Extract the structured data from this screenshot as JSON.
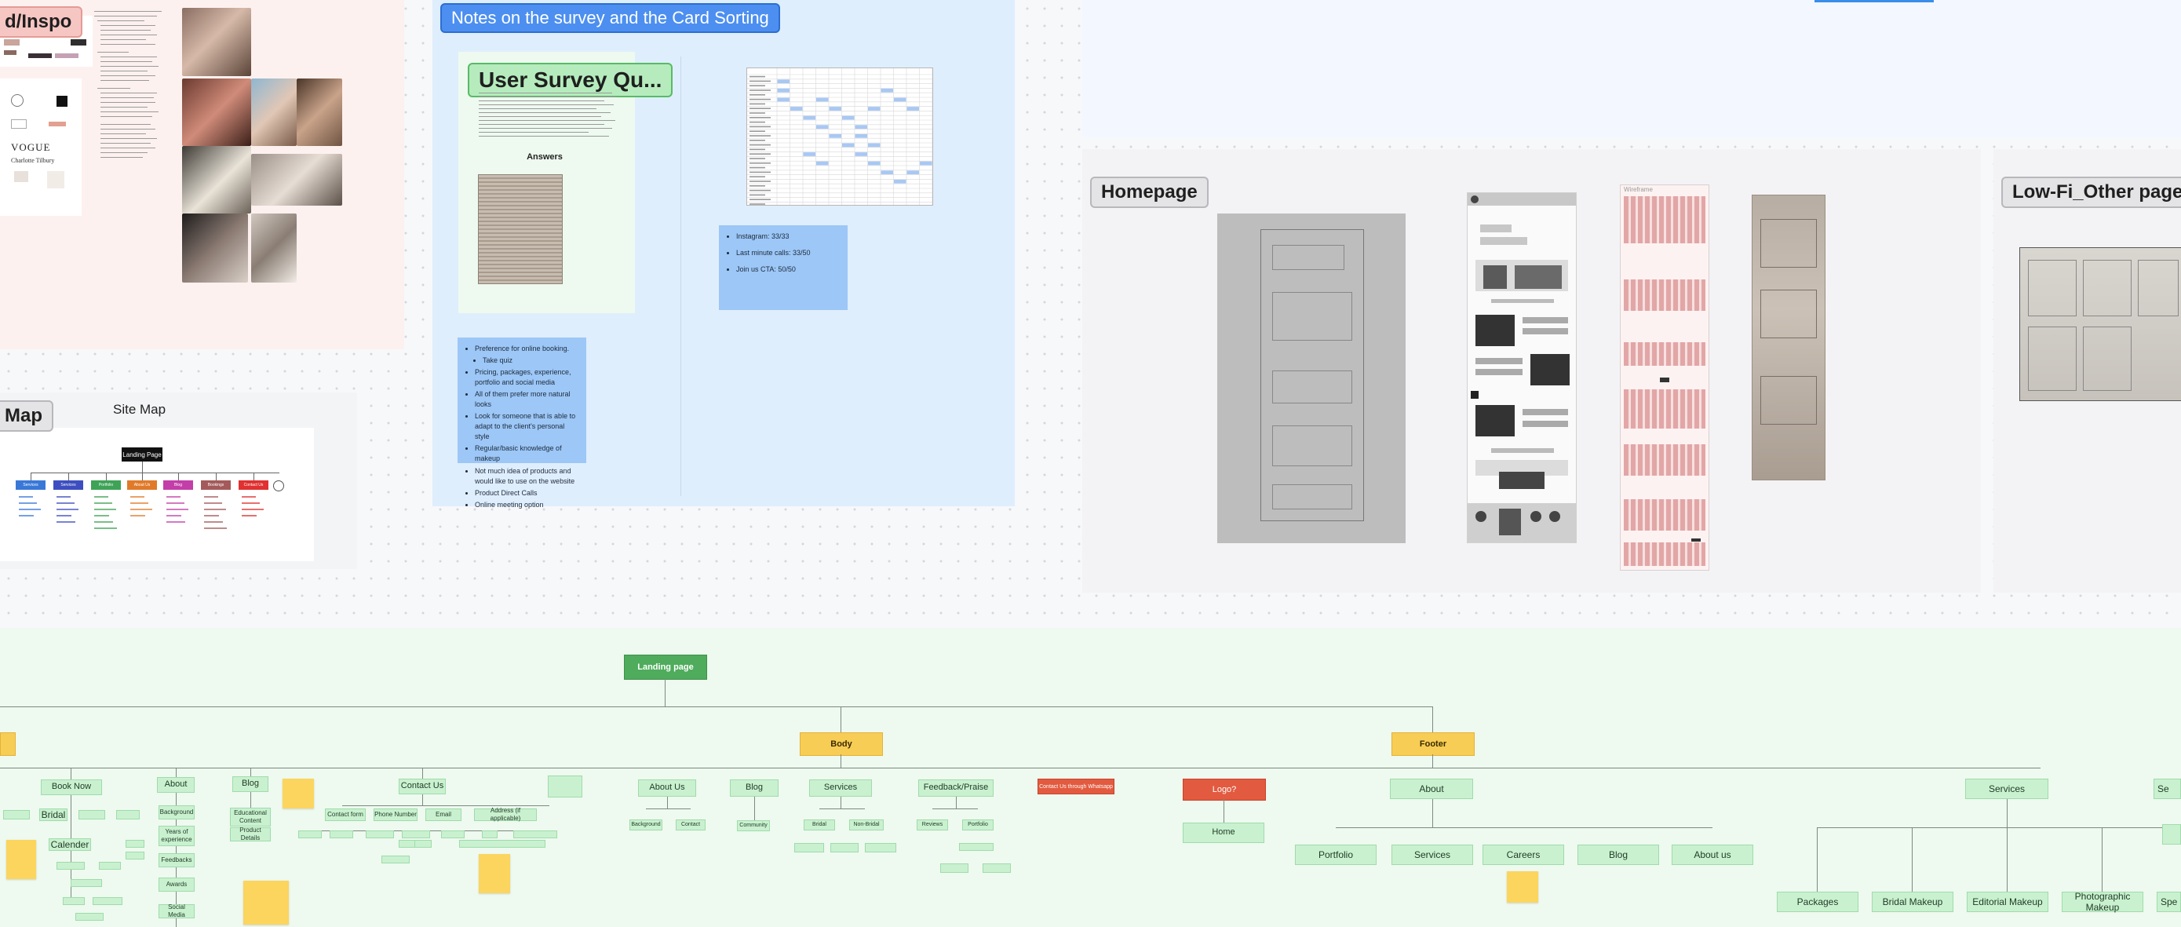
{
  "frames": {
    "moodboard_title": "d/Inspo",
    "notes_title": "Notes on the survey and the Card Sorting",
    "survey_title": "User Survey Qu...",
    "answers_label": "Answers",
    "sitemap_title": "Map",
    "sitemap_subtitle": "Site Map",
    "sitemap_landing": "Landing Page",
    "homepage_title": "Homepage",
    "lowfi_title": "Low-Fi_Other pages",
    "wireframe_label": "Wireframe"
  },
  "moodboard": {
    "vogue_text": "VOGUE",
    "brand_text": "Charlotte Tilbury"
  },
  "notes_sticky": {
    "items": [
      "Preference for online booking.",
      "Take quiz",
      "Pricing, packages, experience, portfolio and social media",
      "All of them prefer more natural looks",
      "Look for someone that is able to adapt to the client's personal style",
      "Regular/basic knowledge of makeup",
      "Not much idea of products and would like to use on the website",
      "Product Direct Calls",
      "Online meeting option"
    ]
  },
  "card_sort_sticky": {
    "items": [
      "Instagram: 33/33",
      "Last minute calls: 33/50",
      "Join us CTA: 50/50"
    ]
  },
  "sitemap_categories": [
    {
      "label": "Services",
      "color": "#3a78d8"
    },
    {
      "label": "Services",
      "color": "#3d4fc0"
    },
    {
      "label": "Portfolio",
      "color": "#3ea356"
    },
    {
      "label": "About Us",
      "color": "#e07a2a"
    },
    {
      "label": "Blog",
      "color": "#c33ea8"
    },
    {
      "label": "Bookings",
      "color": "#a45a5a"
    },
    {
      "label": "Contact Us",
      "color": "#e03030"
    }
  ],
  "ia": {
    "landing": "Landing page",
    "body": "Body",
    "footer": "Footer",
    "logo": "Logo?",
    "home": "Home",
    "left_nodes": [
      "Book Now",
      "About",
      "Blog",
      "Contact Us"
    ],
    "bridal": "Bridal",
    "calender": "Calender",
    "about_children": [
      "Background",
      "Years of experience",
      "Feedbacks",
      "Awards",
      "Social Media"
    ],
    "blog_children": [
      "Educational Content",
      "Product Details"
    ],
    "contact_children": [
      "Contact form",
      "Phone Number",
      "Email",
      "Address (if applicable)"
    ],
    "body_children": [
      "About Us",
      "Blog",
      "Services",
      "Feedback/Praise"
    ],
    "about_us_sub": [
      "Background",
      "Contact"
    ],
    "blog_sub": [
      "Community"
    ],
    "services_sub": [
      "Bridal",
      "Non-Bridal"
    ],
    "feedback_sub": [
      "Reviews",
      "Portfolio"
    ],
    "whatsapp": "Contact Us through Whatsapp",
    "footer_about": "About",
    "footer_about_children": [
      "Portfolio",
      "Services",
      "Careers",
      "Blog",
      "About us"
    ],
    "footer_services": "Services",
    "footer_services_children": [
      "Packages",
      "Bridal Makeup",
      "Editorial Makeup",
      "Photographic Makeup",
      "Spe"
    ],
    "right_edge": "Se"
  }
}
